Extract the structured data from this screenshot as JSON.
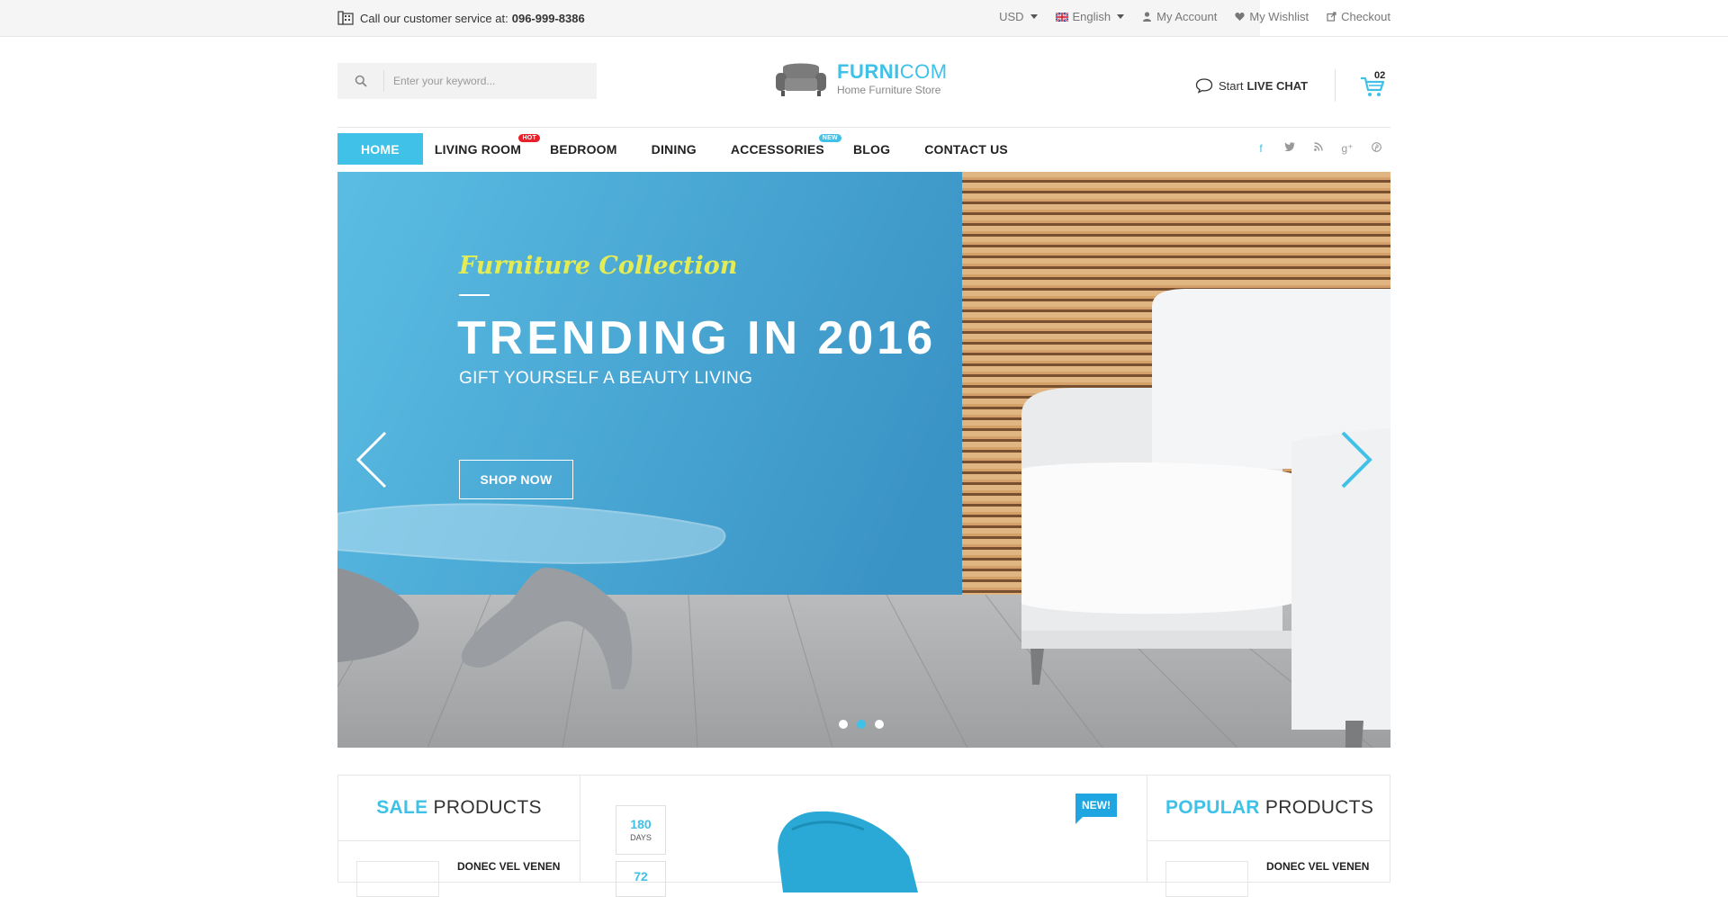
{
  "topbar": {
    "service_text": "Call our customer service at:",
    "phone": "096-999-8386",
    "currency": "USD",
    "language": "English",
    "my_account": "My Account",
    "my_wishlist": "My Wishlist",
    "checkout": "Checkout"
  },
  "header": {
    "search_placeholder": "Enter your keyword...",
    "logo_bold": "FURNI",
    "logo_light": "COM",
    "logo_tagline": "Home Furniture Store",
    "chat_prefix": "Start",
    "chat_strong": "LIVE CHAT",
    "cart_count": "02"
  },
  "nav": {
    "items": [
      {
        "label": "HOME"
      },
      {
        "label": "LIVING ROOM",
        "badge": "HOT"
      },
      {
        "label": "BEDROOM"
      },
      {
        "label": "DINING"
      },
      {
        "label": "ACCESSORIES",
        "badge": "NEW"
      },
      {
        "label": "BLOG"
      },
      {
        "label": "CONTACT US"
      }
    ],
    "social_icons": [
      "facebook-icon",
      "twitter-icon",
      "rss-icon",
      "google-plus-icon",
      "pinterest-icon"
    ]
  },
  "hero": {
    "script_title": "Furniture Collection",
    "headline": "TRENDING IN 2016",
    "subheadline": "GIFT YOURSELF A BEAUTY LIVING",
    "button": "SHOP NOW",
    "slides": 3,
    "active_slide": 2
  },
  "sections": {
    "sale": {
      "title_strong": "SALE",
      "title_rest": "PRODUCTS",
      "first_product": "DONEC VEL VENEN"
    },
    "featured": {
      "countdown_days": "180",
      "countdown_days_label": "DAYS",
      "countdown_next": "72",
      "badge": "NEW!"
    },
    "popular": {
      "title_strong": "POPULAR",
      "title_rest": "PRODUCTS",
      "first_product": "DONEC VEL VENEN"
    }
  },
  "colors": {
    "accent": "#3fc1e8",
    "hot": "#e8202a",
    "script": "#e3ec55",
    "dark": "#222222"
  }
}
